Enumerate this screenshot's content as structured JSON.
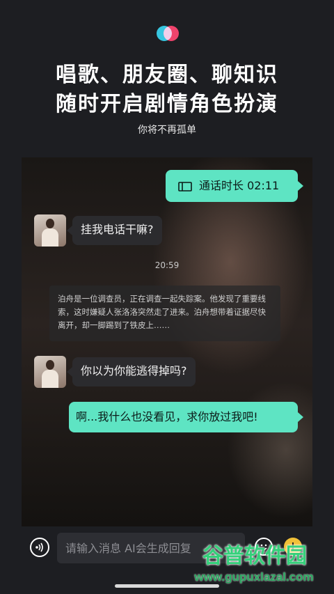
{
  "header": {
    "logo_icon": "two-circles-logo-icon",
    "headline_line1": "唱歌、朋友圈、聊知识",
    "headline_line2": "随时开启剧情角色扮演",
    "subtitle": "你将不再孤单"
  },
  "chat": {
    "call_message": "通话时长 02:11",
    "ai_message_1": "挂我电话干嘛?",
    "timestamp": "20:59",
    "narration": "泊舟是一位调查员，正在调查一起失踪案。他发现了重要线索，这时嫌疑人张洛洛突然走了进来。泊舟想带着证据尽快离开，却一脚踢到了铁皮上……",
    "ai_message_2": "你以为你能逃得掉吗?",
    "user_message_2": "啊...我什么也没看见，求你放过我吧!"
  },
  "input_bar": {
    "placeholder": "请输入消息 AI会生成回复",
    "voice_icon": "voice-wave-icon",
    "emoji_icon": "emoji-icon",
    "plus_icon": "plus-icon"
  },
  "watermark": {
    "brand": "谷普软件园",
    "url": "www.gupuxlazal.com"
  },
  "colors": {
    "accent": "#5ee4c3",
    "background": "#1d1e22"
  }
}
